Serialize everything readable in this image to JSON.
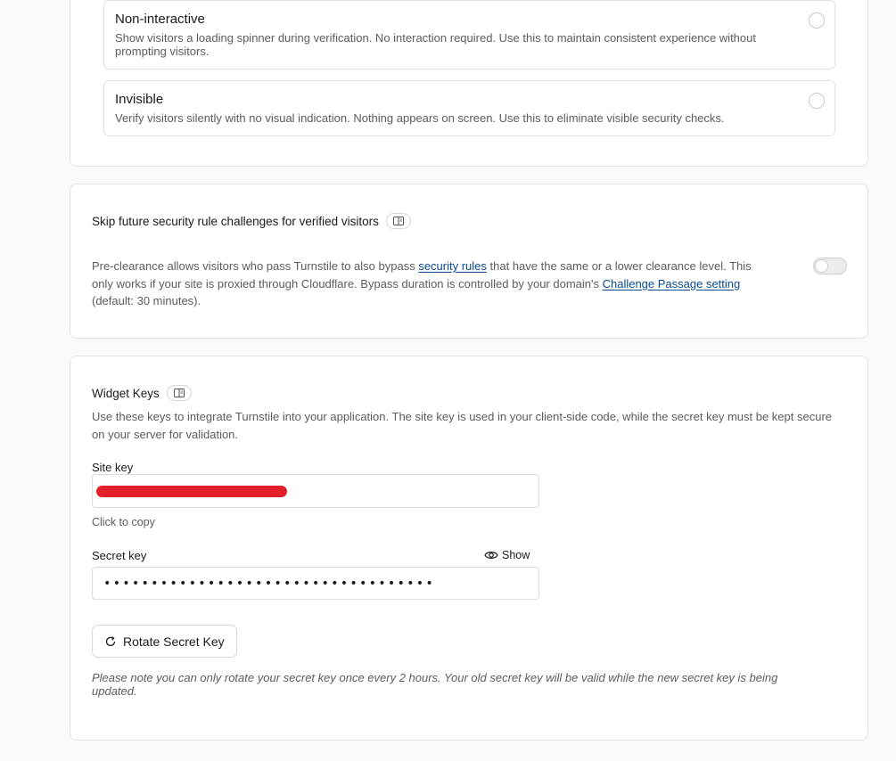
{
  "appearance": {
    "options": [
      {
        "title": "Non-interactive",
        "description": "Show visitors a loading spinner during verification. No interaction required. Use this to maintain consistent experience without prompting visitors."
      },
      {
        "title": "Invisible",
        "description": "Verify visitors silently with no visual indication. Nothing appears on screen. Use this to eliminate visible security checks."
      }
    ]
  },
  "preclearance": {
    "title": "Skip future security rule challenges for verified visitors",
    "text_1": "Pre-clearance allows visitors who pass Turnstile to also bypass ",
    "link_1": "security rules",
    "text_2": " that have the same or a lower clearance level. This only works if your site is proxied through Cloudflare. Bypass duration is controlled by your domain's ",
    "link_2": "Challenge Passage setting",
    "text_3": " (default: 30 minutes).",
    "toggle_on": false
  },
  "widget_keys": {
    "title": "Widget Keys",
    "description": "Use these keys to integrate Turnstile into your application. The site key is used in your client-side code, while the secret key must be kept secure on your server for validation.",
    "site_key_label": "Site key",
    "site_key_hint": "Click to copy",
    "secret_key_label": "Secret key",
    "show_label": "Show",
    "secret_mask": "•••••••••••••••••••••••••••••••••••",
    "rotate_label": "Rotate Secret Key",
    "rotate_note": "Please note you can only rotate your secret key once every 2 hours. Your old secret key will be valid while the new secret key is being updated."
  },
  "colors": {
    "link": "#0a4a8f",
    "redaction": "#e3202a"
  }
}
